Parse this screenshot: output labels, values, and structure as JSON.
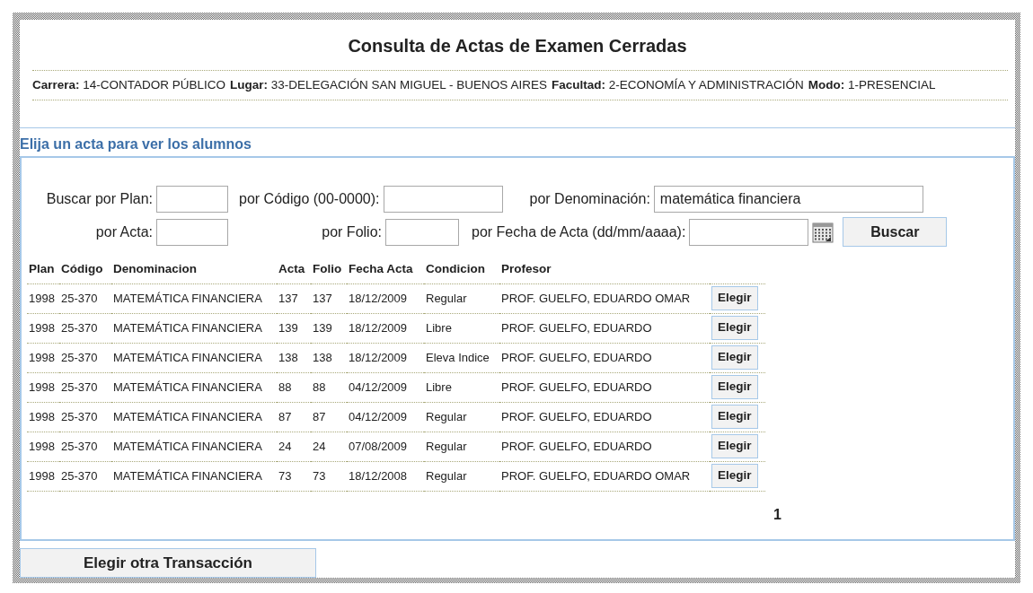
{
  "title": "Consulta de Actas de Examen Cerradas",
  "info": [
    {
      "label": "Carrera:",
      "value": "14-CONTADOR PÚBLICO"
    },
    {
      "label": "Lugar:",
      "value": "33-DELEGACIÓN SAN MIGUEL - BUENOS AIRES"
    },
    {
      "label": "Facultad:",
      "value": "2-ECONOMÍA Y ADMINISTRACIÓN"
    },
    {
      "label": "Modo:",
      "value": "1-PRESENCIAL"
    }
  ],
  "section_title": "Elija un acta para ver los alumnos",
  "search": {
    "rows": [
      [
        {
          "label": "Buscar por Plan:",
          "kind": "text"
        },
        {
          "label": "por Código (00-0000):",
          "kind": "text"
        },
        {
          "label": "por Denominación:",
          "kind": "text",
          "value": "matemática financiera"
        }
      ],
      [
        {
          "label": "por Acta:",
          "kind": "text"
        },
        {
          "label": "por Folio:",
          "kind": "text"
        },
        {
          "label": "por Fecha de Acta (dd/mm/aaaa):",
          "kind": "date"
        }
      ]
    ],
    "button": "Buscar"
  },
  "table": {
    "columns": [
      "Plan",
      "Código",
      "Denominacion",
      "Acta",
      "Folio",
      "Fecha Acta",
      "Condicion",
      "Profesor"
    ],
    "rows": [
      {
        "cells": [
          "1998",
          "25-370",
          "MATEMÁTICA FINANCIERA",
          "137",
          "137",
          "18/12/2009",
          "Regular",
          "PROF. GUELFO, EDUARDO OMAR"
        ],
        "action": "Elegir"
      },
      {
        "cells": [
          "1998",
          "25-370",
          "MATEMÁTICA FINANCIERA",
          "139",
          "139",
          "18/12/2009",
          "Libre",
          "PROF. GUELFO, EDUARDO"
        ],
        "action": "Elegir"
      },
      {
        "cells": [
          "1998",
          "25-370",
          "MATEMÁTICA FINANCIERA",
          "138",
          "138",
          "18/12/2009",
          "Eleva Indice",
          "PROF. GUELFO, EDUARDO"
        ],
        "action": "Elegir"
      },
      {
        "cells": [
          "1998",
          "25-370",
          "MATEMÁTICA FINANCIERA",
          "88",
          "88",
          "04/12/2009",
          "Libre",
          "PROF. GUELFO, EDUARDO"
        ],
        "action": "Elegir"
      },
      {
        "cells": [
          "1998",
          "25-370",
          "MATEMÁTICA FINANCIERA",
          "87",
          "87",
          "04/12/2009",
          "Regular",
          "PROF. GUELFO, EDUARDO"
        ],
        "action": "Elegir"
      },
      {
        "cells": [
          "1998",
          "25-370",
          "MATEMÁTICA FINANCIERA",
          "24",
          "24",
          "07/08/2009",
          "Regular",
          "PROF. GUELFO, EDUARDO"
        ],
        "action": "Elegir"
      },
      {
        "cells": [
          "1998",
          "25-370",
          "MATEMÁTICA FINANCIERA",
          "73",
          "73",
          "18/12/2008",
          "Regular",
          "PROF. GUELFO, EDUARDO OMAR"
        ],
        "action": "Elegir"
      }
    ]
  },
  "pages": [
    {
      "label": "1",
      "selected": true
    }
  ],
  "footer_button": "Elegir otra Transacción"
}
